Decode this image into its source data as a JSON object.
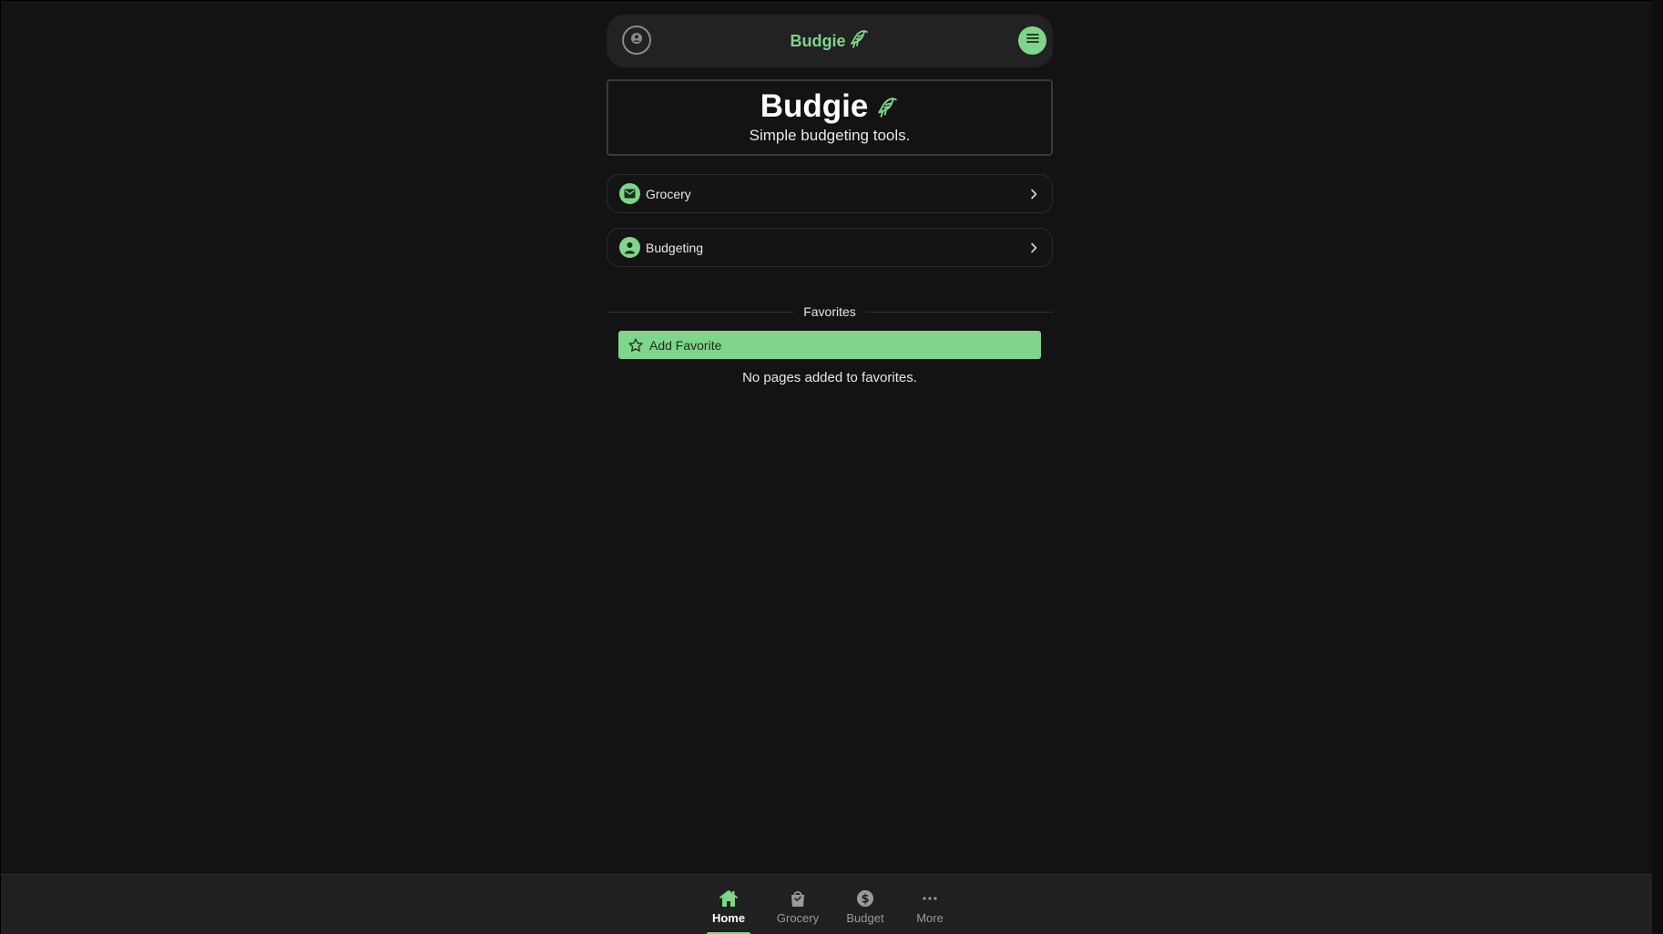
{
  "header": {
    "brand": "Budgie",
    "account_icon": "account-circle-icon",
    "menu_icon": "hamburger-menu-icon"
  },
  "hero": {
    "title": "Budgie",
    "subtitle": "Simple budgeting tools.",
    "logo_icon": "bird-icon"
  },
  "nav": [
    {
      "label": "Grocery",
      "icon": "envelope-icon"
    },
    {
      "label": "Budgeting",
      "icon": "user-icon"
    }
  ],
  "favorites": {
    "heading": "Favorites",
    "add_label": "Add Favorite",
    "empty_message": "No pages added to favorites."
  },
  "bottom_nav": [
    {
      "label": "Home",
      "icon": "home-icon",
      "active": true
    },
    {
      "label": "Grocery",
      "icon": "shopping-bag-icon",
      "active": false
    },
    {
      "label": "Budget",
      "icon": "dollar-coin-icon",
      "active": false
    },
    {
      "label": "More",
      "icon": "more-dots-icon",
      "active": false
    }
  ],
  "colors": {
    "accent": "#7fd58a",
    "background": "#131313",
    "surface": "#222222"
  }
}
